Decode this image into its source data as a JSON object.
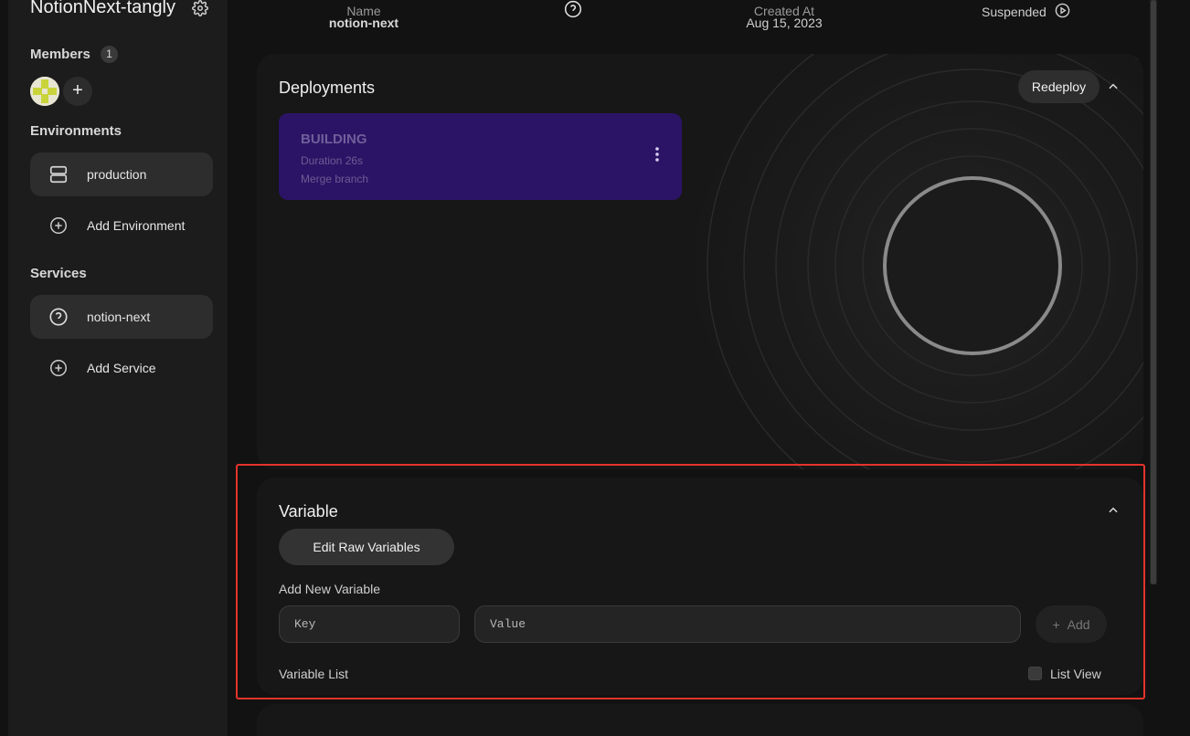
{
  "sidebar": {
    "project_title": "NotionNext-tangly",
    "members_label": "Members",
    "members_count": "1",
    "environments_label": "Environments",
    "environments": [
      {
        "label": "production",
        "icon": "server-icon"
      }
    ],
    "add_environment": "Add Environment",
    "services_label": "Services",
    "services": [
      {
        "label": "notion-next",
        "icon": "question-circle-icon"
      }
    ],
    "add_service": "Add Service"
  },
  "info": {
    "name_head": "Name",
    "name_value": "notion-next",
    "created_head": "Created At",
    "created_value": "Aug 15, 2023",
    "status_value": "Suspended"
  },
  "deployments": {
    "title": "Deployments",
    "redeploy_label": "Redeploy",
    "items": [
      {
        "status": "BUILDING",
        "duration": "Duration 26s",
        "message": "Merge branch"
      }
    ]
  },
  "variable": {
    "title": "Variable",
    "edit_raw_label": "Edit Raw Variables",
    "add_new_label": "Add New Variable",
    "key_placeholder": "Key",
    "value_placeholder": "Value",
    "add_label": "Add",
    "list_label": "Variable List",
    "list_view_label": "List View",
    "list_view_checked": false
  },
  "colors": {
    "deploy_card": "#2b1466",
    "highlight": "#e5342b",
    "sidebar_bg": "#1c1c1c"
  }
}
